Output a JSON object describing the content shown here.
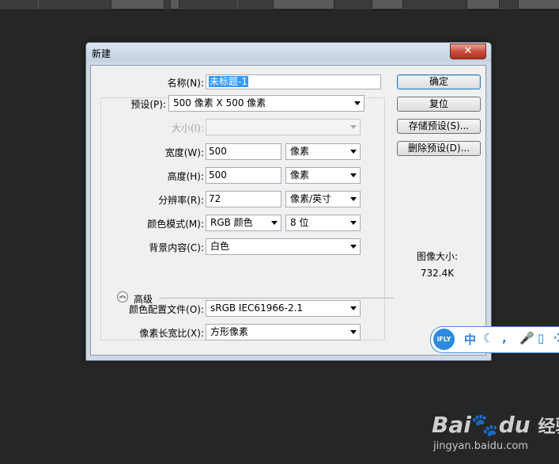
{
  "dialog": {
    "title": "新建",
    "close_icon": "close-icon",
    "name_label": "名称(N):",
    "name_value": "未标题-1",
    "preset_label": "预设(P):",
    "preset_value": "500 像素 X 500 像素",
    "size_label": "大小(I):",
    "size_value": "",
    "width_label": "宽度(W):",
    "width_value": "500",
    "width_unit": "像素",
    "height_label": "高度(H):",
    "height_value": "500",
    "height_unit": "像素",
    "resolution_label": "分辨率(R):",
    "resolution_value": "72",
    "resolution_unit": "像素/英寸",
    "color_mode_label": "颜色模式(M):",
    "color_mode_value": "RGB 颜色",
    "bit_depth_value": "8 位",
    "background_label": "背景内容(C):",
    "background_value": "白色",
    "advanced_label": "高级",
    "color_profile_label": "颜色配置文件(O):",
    "color_profile_value": "sRGB IEC61966-2.1",
    "pixel_aspect_label": "像素长宽比(X):",
    "pixel_aspect_value": "方形像素",
    "buttons": {
      "ok": "确定",
      "reset": "复位",
      "save_preset": "存储预设(S)...",
      "delete_preset": "删除预设(D)..."
    },
    "image_size_label": "图像大小:",
    "image_size_value": "732.4K"
  },
  "ime": {
    "logo": "iFLY",
    "mode": "中",
    "icons": [
      "moon-icon",
      "comma-icon",
      "microphone-icon",
      "keyboard-icon",
      "grid-icon"
    ]
  },
  "watermark": {
    "brand": "Bai",
    "brand2": "du",
    "suffix": "经验",
    "url": "jingyan.baidu.com"
  },
  "colors": {
    "canvas_bg": "#262626",
    "dialog_frame": "#cfd9e6",
    "accent": "#3399ff",
    "close_red": "#c8473a"
  }
}
